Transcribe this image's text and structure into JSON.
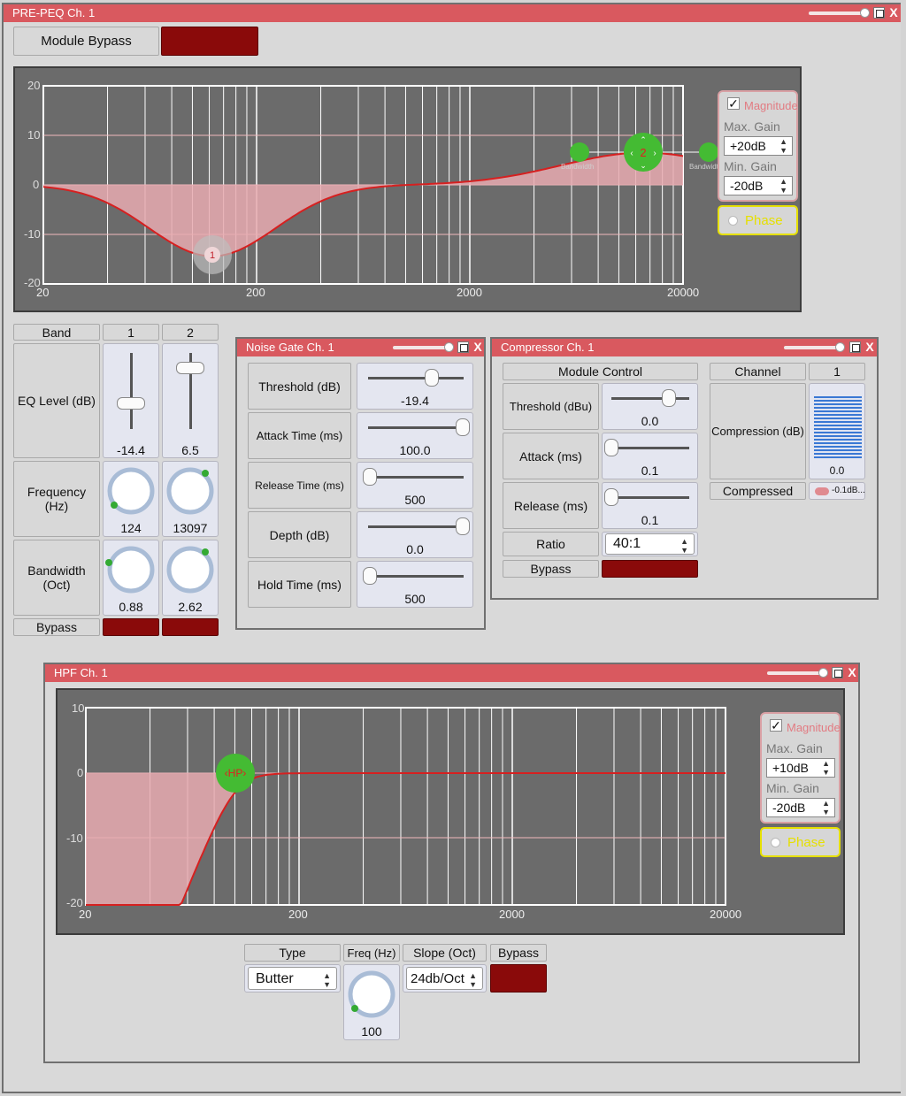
{
  "peq": {
    "title": "PRE-PEQ Ch. 1",
    "module_bypass_label": "Module Bypass",
    "graph": {
      "y_ticks": [
        "20",
        "10",
        "0",
        "-10",
        "-20"
      ],
      "x_ticks": [
        "20",
        "200",
        "2000",
        "20000"
      ],
      "band_markers": [
        "1",
        "2"
      ],
      "bandwidth_label": "Bandwidth",
      "magnitude_label": "Magnitude",
      "max_gain_label": "Max. Gain",
      "max_gain_value": "+20dB",
      "min_gain_label": "Min. Gain",
      "min_gain_value": "-20dB",
      "phase_label": "Phase"
    },
    "table": {
      "band_header": "Band",
      "band_1": "1",
      "band_2": "2",
      "eq_level_label": "EQ Level (dB)",
      "eq_level_1": "-14.4",
      "eq_level_2": "6.5",
      "frequency_label": "Frequency (Hz)",
      "frequency_1": "124",
      "frequency_2": "13097",
      "bandwidth_label": "Bandwidth (Oct)",
      "bandwidth_1": "0.88",
      "bandwidth_2": "2.62",
      "bypass_label": "Bypass"
    }
  },
  "noise_gate": {
    "title": "Noise Gate Ch. 1",
    "threshold_label": "Threshold (dB)",
    "threshold_value": "-19.4",
    "attack_label": "Attack Time (ms)",
    "attack_value": "100.0",
    "release_label": "Release Time (ms)",
    "release_value": "500",
    "depth_label": "Depth (dB)",
    "depth_value": "0.0",
    "hold_label": "Hold Time (ms)",
    "hold_value": "500"
  },
  "compressor": {
    "title": "Compressor Ch. 1",
    "module_control_label": "Module Control",
    "threshold_label": "Threshold (dBu)",
    "threshold_value": "0.0",
    "attack_label": "Attack (ms)",
    "attack_value": "0.1",
    "release_label": "Release (ms)",
    "release_value": "0.1",
    "ratio_label": "Ratio",
    "ratio_value": "40:1",
    "bypass_label": "Bypass",
    "channel_label": "Channel",
    "channel_value": "1",
    "compression_label": "Compression (dB)",
    "compression_value": "0.0",
    "compressed_label": "Compressed",
    "compressed_value": "-0.1dB..."
  },
  "hpf": {
    "title": "HPF Ch. 1",
    "graph": {
      "y_ticks": [
        "10",
        "0",
        "-10",
        "-20"
      ],
      "x_ticks": [
        "20",
        "200",
        "2000",
        "20000"
      ],
      "hp_marker": "‹HP›",
      "magnitude_label": "Magnitude",
      "max_gain_label": "Max. Gain",
      "max_gain_value": "+10dB",
      "min_gain_label": "Min. Gain",
      "min_gain_value": "-20dB",
      "phase_label": "Phase"
    },
    "type_label": "Type",
    "type_value": "Butter",
    "freq_label": "Freq (Hz)",
    "freq_value": "100",
    "slope_label": "Slope (Oct)",
    "slope_value": "24db/Oct",
    "bypass_label": "Bypass"
  },
  "colors": {
    "title_bar": "#d9595f",
    "bypass_active": "#8a0a0a",
    "curve": "#d62020",
    "node_green": "#44bb33",
    "phase_yellow": "#e6e000"
  }
}
